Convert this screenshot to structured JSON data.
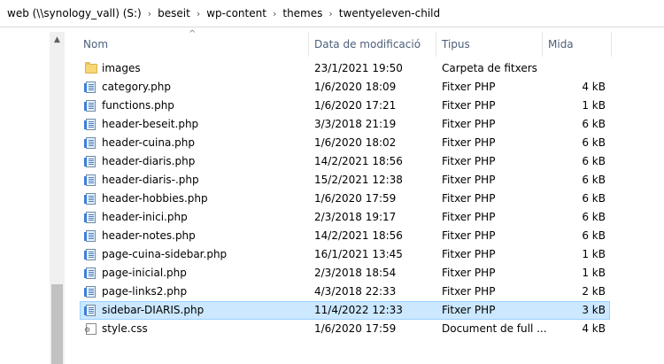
{
  "breadcrumb": [
    "web (\\\\synology_vall) (S:)",
    "beseit",
    "wp-content",
    "themes",
    "twentyeleven-child"
  ],
  "columns": {
    "name": "Nom",
    "date": "Data de modificació",
    "type": "Tipus",
    "size": "Mida"
  },
  "files": [
    {
      "name": "images",
      "date": "23/1/2021 19:50",
      "type": "Carpeta de fitxers",
      "size": "",
      "icon": "folder-icon"
    },
    {
      "name": "category.php",
      "date": "1/6/2020 18:09",
      "type": "Fitxer PHP",
      "size": "4 kB",
      "icon": "php-file-icon"
    },
    {
      "name": "functions.php",
      "date": "1/6/2020 17:21",
      "type": "Fitxer PHP",
      "size": "1 kB",
      "icon": "php-file-icon"
    },
    {
      "name": "header-beseit.php",
      "date": "3/3/2018 21:19",
      "type": "Fitxer PHP",
      "size": "6 kB",
      "icon": "php-file-icon"
    },
    {
      "name": "header-cuina.php",
      "date": "1/6/2020 18:02",
      "type": "Fitxer PHP",
      "size": "6 kB",
      "icon": "php-file-icon"
    },
    {
      "name": "header-diaris.php",
      "date": "14/2/2021 18:56",
      "type": "Fitxer PHP",
      "size": "6 kB",
      "icon": "php-file-icon"
    },
    {
      "name": "header-diaris-.php",
      "date": "15/2/2021 12:38",
      "type": "Fitxer PHP",
      "size": "6 kB",
      "icon": "php-file-icon"
    },
    {
      "name": "header-hobbies.php",
      "date": "1/6/2020 17:59",
      "type": "Fitxer PHP",
      "size": "6 kB",
      "icon": "php-file-icon"
    },
    {
      "name": "header-inici.php",
      "date": "2/3/2018 19:17",
      "type": "Fitxer PHP",
      "size": "6 kB",
      "icon": "php-file-icon"
    },
    {
      "name": "header-notes.php",
      "date": "14/2/2021 18:56",
      "type": "Fitxer PHP",
      "size": "6 kB",
      "icon": "php-file-icon"
    },
    {
      "name": "page-cuina-sidebar.php",
      "date": "16/1/2021 13:45",
      "type": "Fitxer PHP",
      "size": "1 kB",
      "icon": "php-file-icon"
    },
    {
      "name": "page-inicial.php",
      "date": "2/3/2018 18:54",
      "type": "Fitxer PHP",
      "size": "1 kB",
      "icon": "php-file-icon"
    },
    {
      "name": "page-links2.php",
      "date": "4/3/2018 22:33",
      "type": "Fitxer PHP",
      "size": "2 kB",
      "icon": "php-file-icon"
    },
    {
      "name": "sidebar-DIARIS.php",
      "date": "11/4/2022 12:33",
      "type": "Fitxer PHP",
      "size": "3 kB",
      "icon": "php-file-icon",
      "selected": true
    },
    {
      "name": "style.css",
      "date": "1/6/2020 17:59",
      "type": "Document de full ...",
      "size": "4 kB",
      "icon": "css-file-icon"
    }
  ]
}
